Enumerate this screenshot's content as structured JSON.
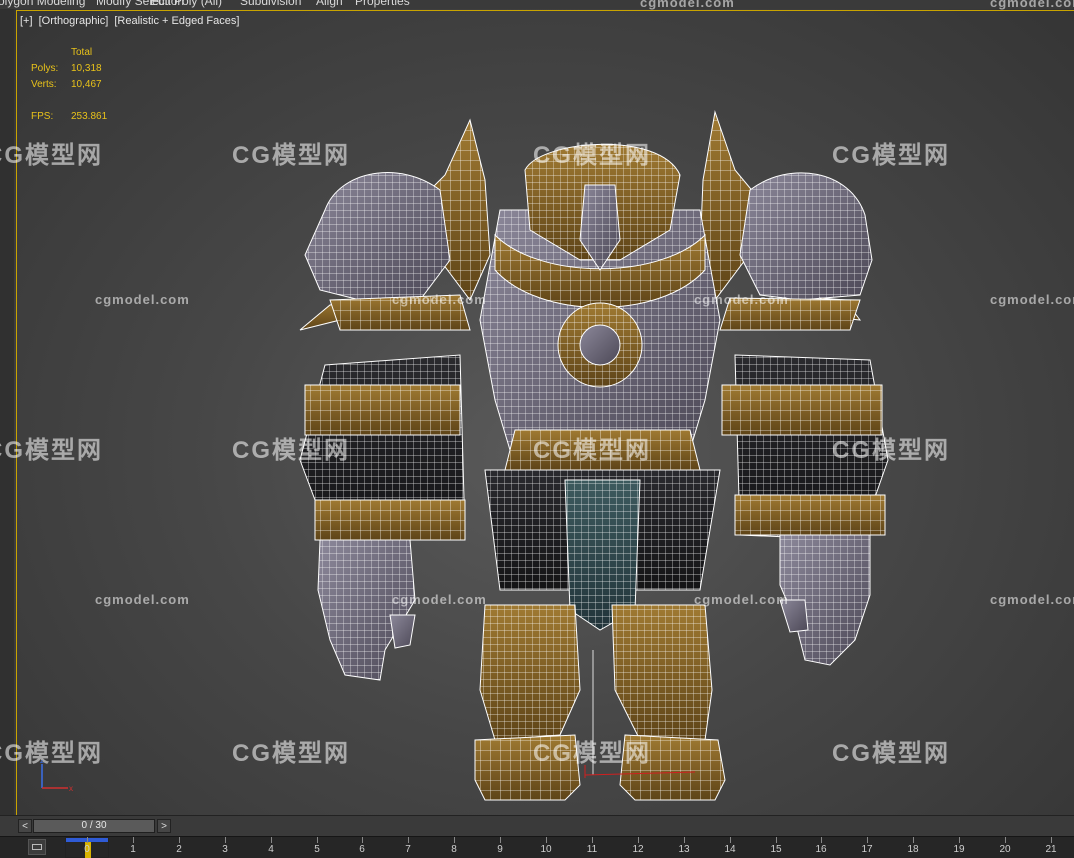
{
  "ribbon": {
    "items": [
      "Polygon Modeling",
      "Modify Selection",
      "Edit Poly (All)",
      "Subdivision",
      "Align",
      "Properties"
    ]
  },
  "viewport": {
    "label_plus": "[+]",
    "label_view": "[Orthographic]",
    "label_shading": "[Realistic + Edged Faces]",
    "stats": {
      "header": "Total",
      "polys_label": "Polys:",
      "polys_value": "10,318",
      "verts_label": "Verts:",
      "verts_value": "10,467",
      "fps_label": "FPS:",
      "fps_value": "253.861"
    },
    "stats_color": "#e8c21a"
  },
  "watermark": {
    "latin": "cgmodel.com",
    "cn": "CG模型网"
  },
  "timeline": {
    "prev": "<",
    "next": ">",
    "position": "0 / 30",
    "ticks": [
      "0",
      "1",
      "2",
      "3",
      "4",
      "5",
      "6",
      "7",
      "8",
      "9",
      "10",
      "11",
      "12",
      "13",
      "14",
      "15",
      "16",
      "17",
      "18",
      "19",
      "20",
      "21"
    ]
  },
  "colors": {
    "viewport_border": "#c9a400",
    "wire": "#ffffff",
    "armor_gold": "#8a6a2a",
    "armor_stone": "#6e6a78",
    "time_marker_top": "#2f5bd6",
    "time_marker_current": "#d9b400"
  }
}
